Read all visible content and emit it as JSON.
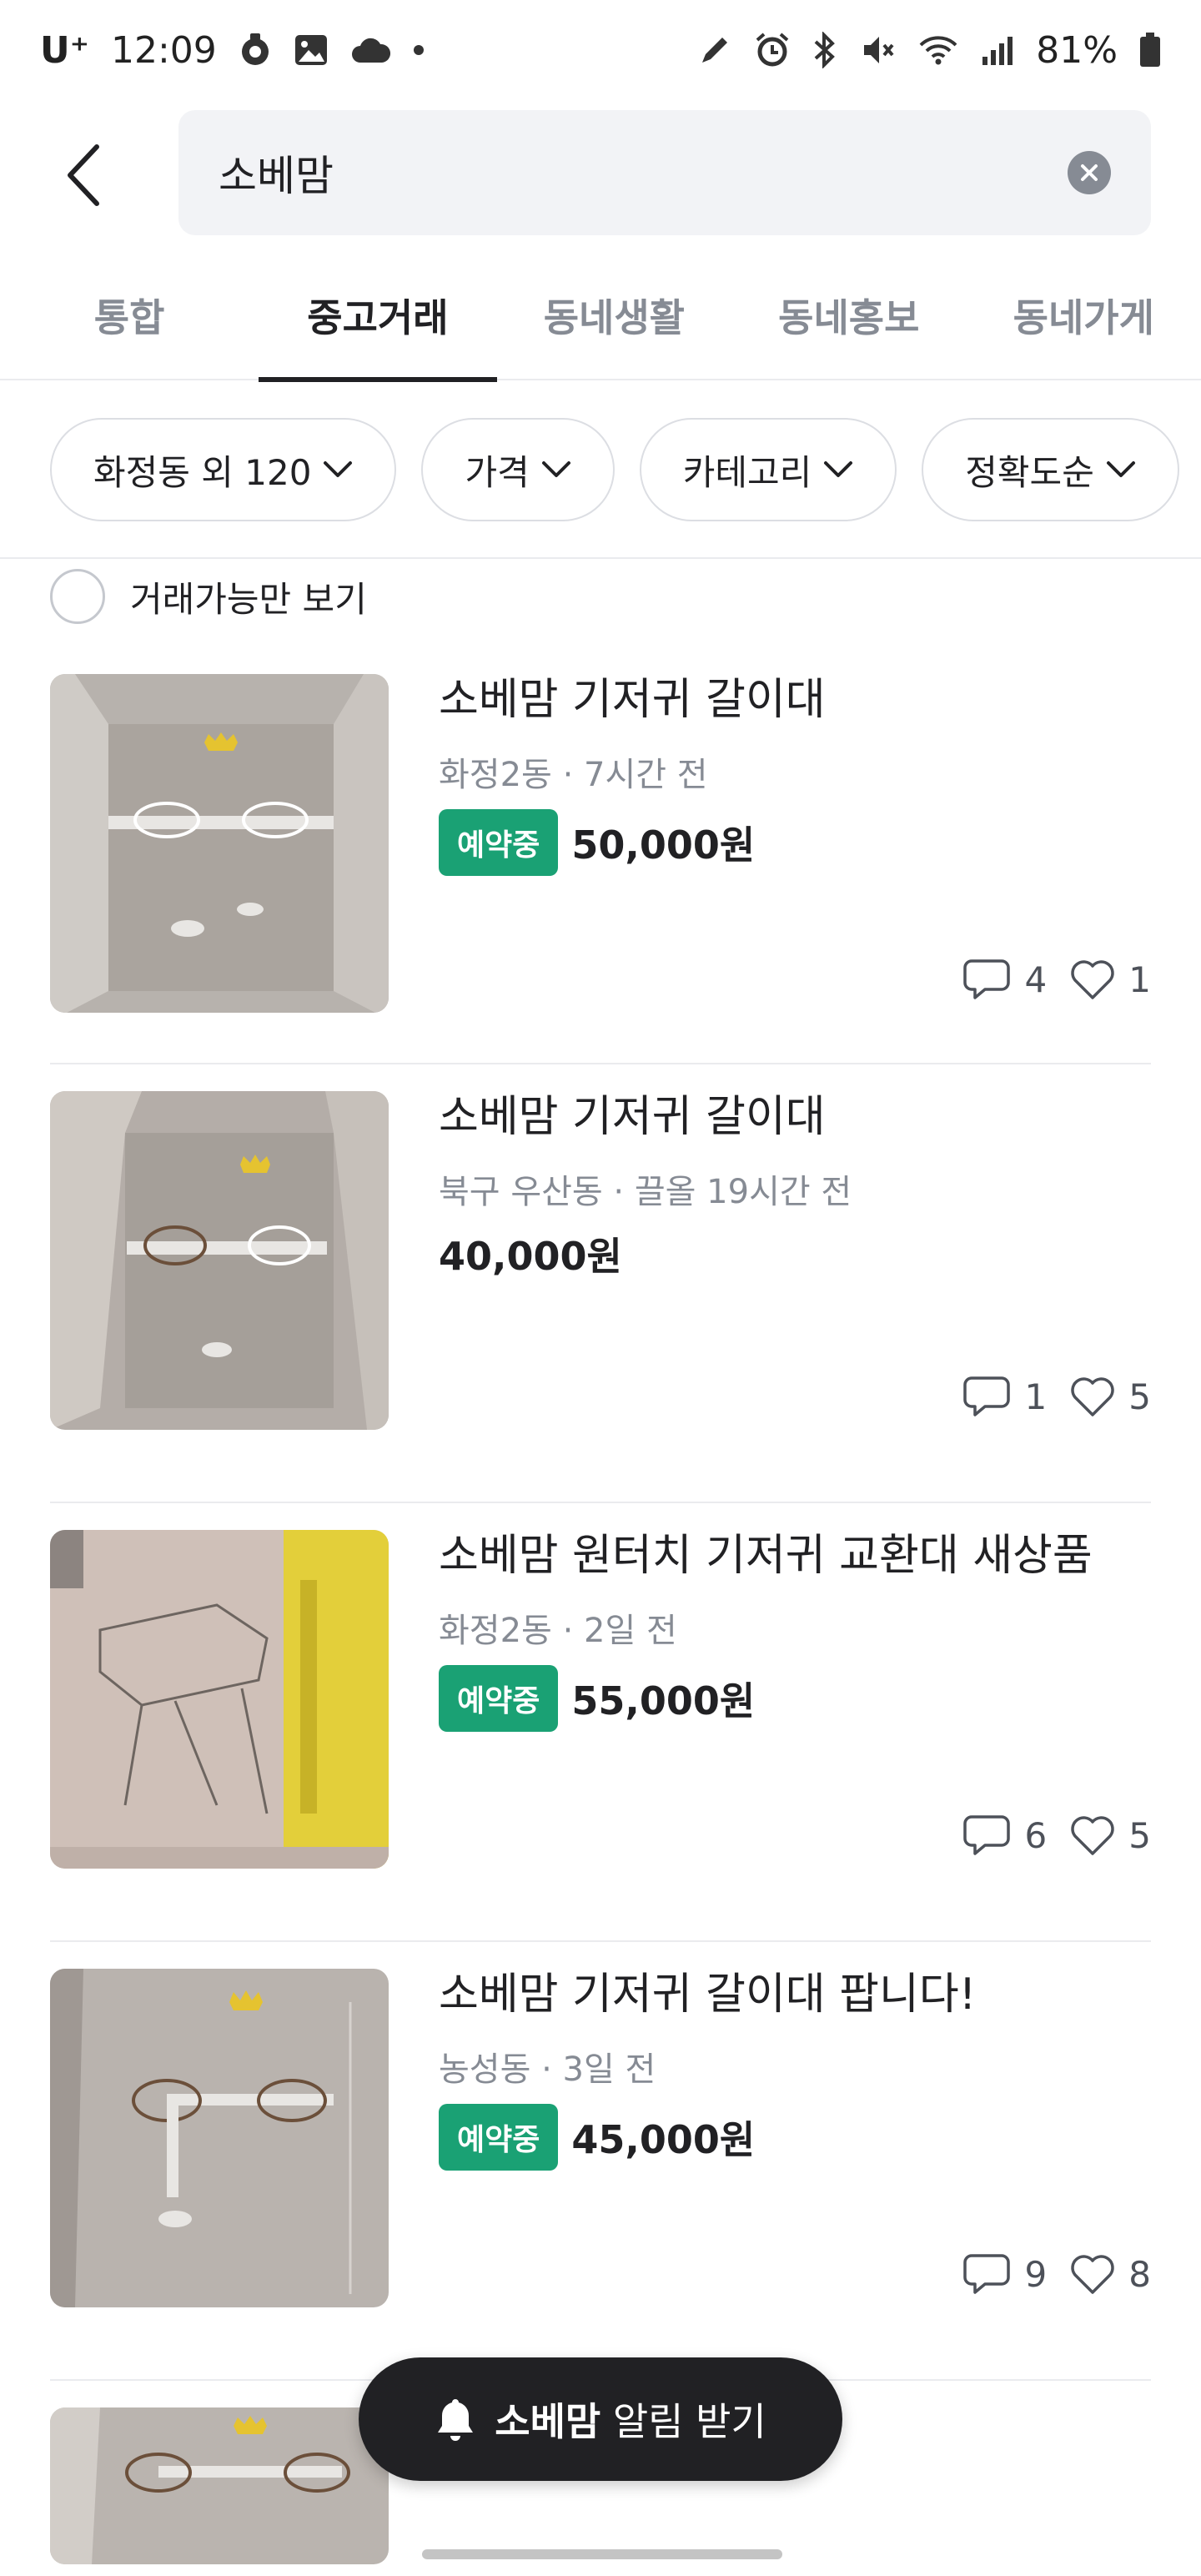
{
  "status_bar": {
    "carrier": "U⁺",
    "time": "12:09",
    "battery": "81%"
  },
  "search": {
    "query": "소베맘"
  },
  "tabs": [
    {
      "label": "통합",
      "active": false
    },
    {
      "label": "중고거래",
      "active": true
    },
    {
      "label": "동네생활",
      "active": false
    },
    {
      "label": "동네홍보",
      "active": false
    },
    {
      "label": "동네가게",
      "active": false
    }
  ],
  "filters": [
    {
      "label": "화정동 외 120"
    },
    {
      "label": "가격"
    },
    {
      "label": "카테고리"
    },
    {
      "label": "정확도순"
    }
  ],
  "available_only_label": "거래가능만 보기",
  "items": [
    {
      "title": "소베맘 기저귀 갈이대",
      "meta": "화정2동 · 7시간 전",
      "badge": "예약중",
      "price": "50,000원",
      "comments": "4",
      "likes": "1"
    },
    {
      "title": "소베맘 기저귀 갈이대",
      "meta": "북구 우산동 · 끌올 19시간 전",
      "badge": "",
      "price": "40,000원",
      "comments": "1",
      "likes": "5"
    },
    {
      "title": "소베맘 원터치 기저귀 교환대 새상품",
      "meta": "화정2동 · 2일 전",
      "badge": "예약중",
      "price": "55,000원",
      "comments": "6",
      "likes": "5"
    },
    {
      "title": "소베맘 기저귀 갈이대 팝니다!",
      "meta": "농성동 · 3일 전",
      "badge": "예약중",
      "price": "45,000원",
      "comments": "9",
      "likes": "8"
    }
  ],
  "alert_button": {
    "keyword": "소베맘",
    "label": "알림 받기"
  },
  "colors": {
    "accent_green": "#1aa174",
    "text_primary": "#212124",
    "text_secondary": "#868b94"
  }
}
